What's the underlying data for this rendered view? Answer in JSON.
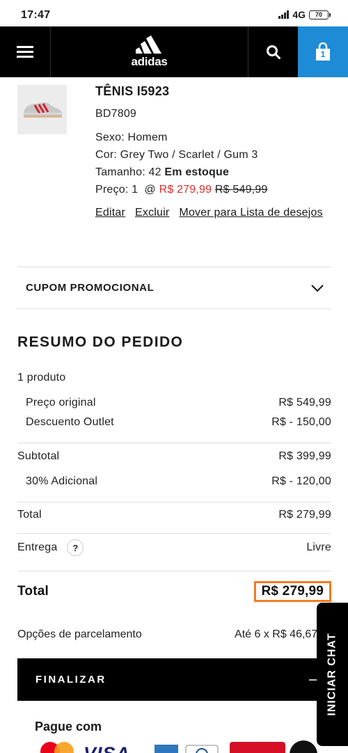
{
  "status_bar": {
    "time": "17:47",
    "network": "4G",
    "battery": "70"
  },
  "navbar": {
    "logo_text": "adidas",
    "cart_count": "1"
  },
  "product": {
    "title": "TÊNIS I5923",
    "sku": "BD7809",
    "gender": "Sexo: Homem",
    "color": "Cor: Grey Two / Scarlet / Gum 3",
    "size_label": "Tamanho: 42",
    "stock": "Em estoque",
    "price_label": "Preço: 1  @",
    "sale_price": "R$ 279,99",
    "original_price": "R$ 549,99",
    "actions": {
      "edit": "Editar",
      "delete": "Excluir",
      "wishlist": "Mover para Lista de desejos"
    }
  },
  "coupon": {
    "label": "CUPOM PROMOCIONAL"
  },
  "summary": {
    "title": "RESUMO DO PEDIDO",
    "product_count": "1 produto",
    "rows": [
      {
        "label": "Preço original",
        "value": "R$ 549,99"
      },
      {
        "label": "Descuento Outlet",
        "value": "R$ - 150,00"
      },
      {
        "label": "Subtotal",
        "value": "R$ 399,99"
      },
      {
        "label": "30% Adicional",
        "value": "R$ - 120,00"
      },
      {
        "label": "Total",
        "value": "R$ 279,99"
      },
      {
        "label": "Entrega",
        "value": "Livre"
      }
    ],
    "help_glyph": "?",
    "grand_total_label": "Total",
    "grand_total_value": "R$ 279,99",
    "installments_label": "Opções de parcelamento",
    "installments_value": "Até 6 x R$ 46,67 sem juros"
  },
  "finalize": {
    "label": "FINALIZAR"
  },
  "chat": {
    "label": "INICIAR CHAT"
  },
  "payment": {
    "title": "Pague com",
    "visa_text": "VISA",
    "brand_colors": {
      "mastercard_red": "#eb001b",
      "mastercard_yellow": "#f79e1b",
      "visa_blue": "#1a1f71",
      "amex_blue": "#2e77bc",
      "red_brand": "#d50f25"
    }
  },
  "colors": {
    "accent_blue": "#1e8bd6",
    "sale_red": "#e32b2b",
    "highlight_orange": "#f47b20"
  }
}
